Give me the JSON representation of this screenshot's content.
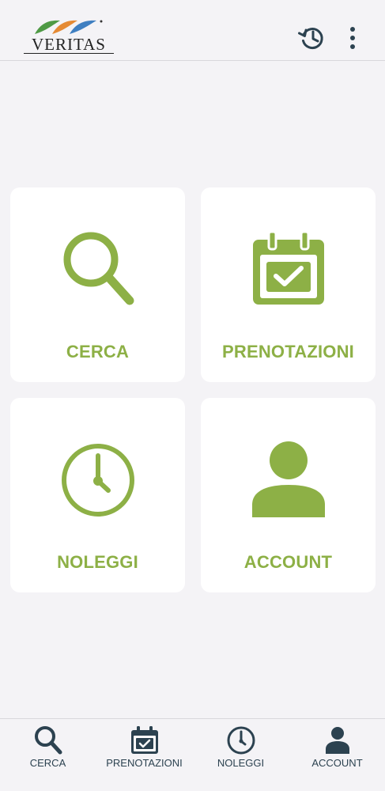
{
  "header": {
    "logo_text": "VERITAS"
  },
  "tiles": [
    {
      "label": "CERCA"
    },
    {
      "label": "PRENOTAZIONI"
    },
    {
      "label": "NOLEGGI"
    },
    {
      "label": "ACCOUNT"
    }
  ],
  "bottom_nav": [
    {
      "label": "CERCA"
    },
    {
      "label": "PRENOTAZIONI"
    },
    {
      "label": "NOLEGGI"
    },
    {
      "label": "ACCOUNT"
    }
  ],
  "icons": {
    "tile_cerca": "search-icon",
    "tile_prenotazioni": "calendar-check-icon",
    "tile_noleggi": "clock-icon",
    "tile_account": "user-icon",
    "header_history": "history-icon",
    "header_more": "more-vertical-icon"
  },
  "colors": {
    "accent": "#8db046",
    "nav_icon": "#2c4250",
    "background": "#f4f3f6",
    "tile": "#ffffff"
  }
}
